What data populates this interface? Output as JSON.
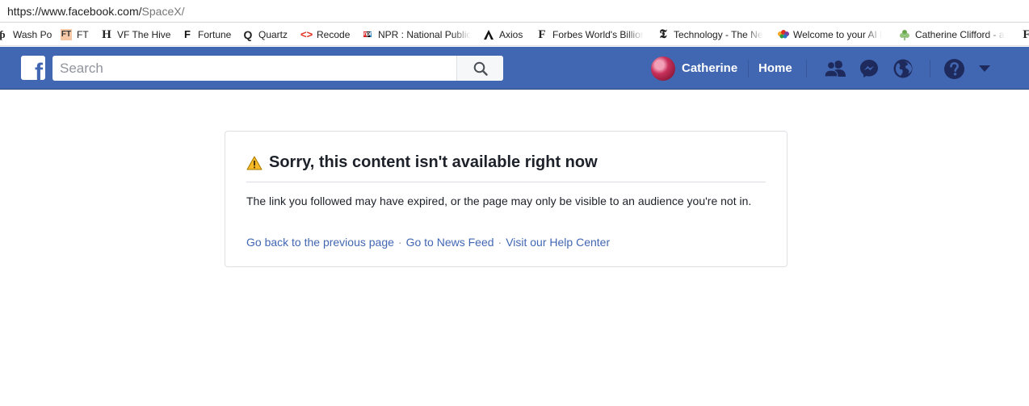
{
  "browser": {
    "url_host": "https://www.facebook.com/",
    "url_path": "SpaceX/"
  },
  "bookmarks": [
    {
      "label": "Wash Po",
      "icon": "wash-post-icon"
    },
    {
      "label": "FT",
      "icon": "ft-icon"
    },
    {
      "label": "VF The Hive",
      "icon": "hive-icon"
    },
    {
      "label": "Fortune",
      "icon": "fortune-icon"
    },
    {
      "label": "Quartz",
      "icon": "quartz-icon"
    },
    {
      "label": "Recode",
      "icon": "recode-icon"
    },
    {
      "label": "NPR : National Public",
      "icon": "npr-icon"
    },
    {
      "label": "Axios",
      "icon": "axios-icon"
    },
    {
      "label": "Forbes World's Billior",
      "icon": "forbes-icon"
    },
    {
      "label": "Technology - The Ne",
      "icon": "nyt-icon"
    },
    {
      "label": "Welcome to your AI l",
      "icon": "nbc-icon"
    },
    {
      "label": "Catherine Clifford - a",
      "icon": "leaf-icon"
    }
  ],
  "header": {
    "search_placeholder": "Search",
    "profile_name": "Catherine",
    "home_label": "Home"
  },
  "error": {
    "title": "Sorry, this content isn't available right now",
    "message": "The link you followed may have expired, or the page may only be visible to an audience you're not in.",
    "links": [
      "Go back to the previous page",
      "Go to News Feed",
      "Visit our Help Center"
    ],
    "separator": "·"
  },
  "colors": {
    "brand_blue": "#4267b2",
    "warning_yellow": "#f7b928"
  }
}
